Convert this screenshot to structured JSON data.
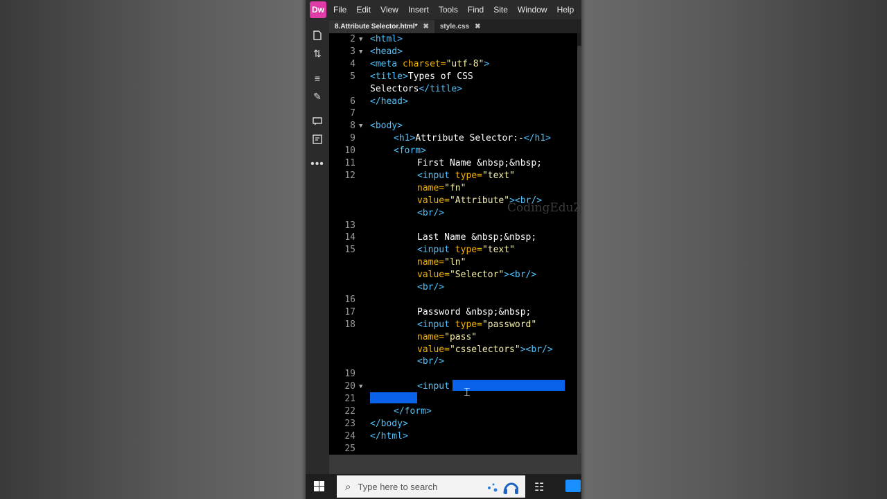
{
  "app": {
    "logo": "Dw",
    "menu": [
      "File",
      "Edit",
      "View",
      "Insert",
      "Tools",
      "Find",
      "Site",
      "Window",
      "Help"
    ]
  },
  "tabs": [
    {
      "label": "8.Attribute Selector.html*",
      "active": true
    },
    {
      "label": "style.css",
      "active": false
    }
  ],
  "toolbar_icons": [
    "file-icon",
    "sort-icon",
    "properties-icon",
    "brush-icon",
    "comment-icon",
    "code-nav-icon",
    "more-icon"
  ],
  "watermark": "CodingEduZ",
  "editor_lines": [
    {
      "n": "2",
      "fold": true,
      "indent": 0,
      "segs": [
        [
          "tag",
          "<html>"
        ]
      ]
    },
    {
      "n": "3",
      "fold": true,
      "indent": 0,
      "segs": [
        [
          "tag",
          "<head>"
        ]
      ]
    },
    {
      "n": "4",
      "fold": false,
      "indent": 0,
      "segs": [
        [
          "tag",
          "<meta "
        ],
        [
          "attr",
          "charset="
        ],
        [
          "str",
          "\"utf-8\""
        ],
        [
          "tag",
          ">"
        ]
      ]
    },
    {
      "n": "5",
      "fold": false,
      "indent": 0,
      "segs": [
        [
          "tag",
          "<title>"
        ],
        [
          "txt",
          "Types of CSS"
        ]
      ]
    },
    {
      "n": "",
      "fold": false,
      "indent": 0,
      "segs": [
        [
          "txt",
          "Selectors"
        ],
        [
          "tag",
          "</title>"
        ]
      ]
    },
    {
      "n": "6",
      "fold": false,
      "indent": 0,
      "segs": [
        [
          "tag",
          "</head>"
        ]
      ]
    },
    {
      "n": "7",
      "fold": false,
      "indent": 0,
      "segs": []
    },
    {
      "n": "8",
      "fold": true,
      "indent": 0,
      "segs": [
        [
          "tag",
          "<body>"
        ]
      ]
    },
    {
      "n": "9",
      "fold": false,
      "indent": 1,
      "segs": [
        [
          "tag",
          "<h1>"
        ],
        [
          "txt",
          "Attribute Selector:-"
        ],
        [
          "tag",
          "</h1>"
        ]
      ]
    },
    {
      "n": "10",
      "fold": false,
      "indent": 1,
      "segs": [
        [
          "tag",
          "<form>"
        ]
      ]
    },
    {
      "n": "11",
      "fold": false,
      "indent": 2,
      "segs": [
        [
          "txt",
          "First Name &nbsp;&nbsp;"
        ]
      ]
    },
    {
      "n": "12",
      "fold": false,
      "indent": 2,
      "segs": [
        [
          "tag",
          "<input "
        ],
        [
          "attr",
          "type="
        ],
        [
          "str",
          "\"text\""
        ]
      ]
    },
    {
      "n": "",
      "fold": false,
      "indent": 2,
      "segs": [
        [
          "attr",
          "name="
        ],
        [
          "str",
          "\"fn\""
        ]
      ]
    },
    {
      "n": "",
      "fold": false,
      "indent": 2,
      "segs": [
        [
          "attr",
          "value="
        ],
        [
          "str",
          "\"Attribute\""
        ],
        [
          "tag",
          "><br/>"
        ]
      ]
    },
    {
      "n": "",
      "fold": false,
      "indent": 2,
      "segs": [
        [
          "tag",
          "<br/>"
        ]
      ]
    },
    {
      "n": "13",
      "fold": false,
      "indent": 0,
      "segs": []
    },
    {
      "n": "14",
      "fold": false,
      "indent": 2,
      "segs": [
        [
          "txt",
          "Last Name &nbsp;&nbsp;"
        ]
      ]
    },
    {
      "n": "15",
      "fold": false,
      "indent": 2,
      "segs": [
        [
          "tag",
          "<input "
        ],
        [
          "attr",
          "type="
        ],
        [
          "str",
          "\"text\""
        ]
      ]
    },
    {
      "n": "",
      "fold": false,
      "indent": 2,
      "segs": [
        [
          "attr",
          "name="
        ],
        [
          "str",
          "\"ln\""
        ]
      ]
    },
    {
      "n": "",
      "fold": false,
      "indent": 2,
      "segs": [
        [
          "attr",
          "value="
        ],
        [
          "str",
          "\"Selector\""
        ],
        [
          "tag",
          "><br/>"
        ]
      ]
    },
    {
      "n": "",
      "fold": false,
      "indent": 2,
      "segs": [
        [
          "tag",
          "<br/>"
        ]
      ]
    },
    {
      "n": "16",
      "fold": false,
      "indent": 0,
      "segs": []
    },
    {
      "n": "17",
      "fold": false,
      "indent": 2,
      "segs": [
        [
          "txt",
          "Password &nbsp;&nbsp;"
        ]
      ]
    },
    {
      "n": "18",
      "fold": false,
      "indent": 2,
      "segs": [
        [
          "tag",
          "<input "
        ],
        [
          "attr",
          "type="
        ],
        [
          "str",
          "\"password\""
        ]
      ]
    },
    {
      "n": "",
      "fold": false,
      "indent": 2,
      "segs": [
        [
          "attr",
          "name="
        ],
        [
          "str",
          "\"pass\""
        ]
      ]
    },
    {
      "n": "",
      "fold": false,
      "indent": 2,
      "segs": [
        [
          "attr",
          "value="
        ],
        [
          "str",
          "\"csselectors\""
        ],
        [
          "tag",
          "><br/>"
        ]
      ]
    },
    {
      "n": "",
      "fold": false,
      "indent": 2,
      "segs": [
        [
          "tag",
          "<br/>"
        ]
      ]
    },
    {
      "n": "19",
      "fold": false,
      "indent": 0,
      "segs": []
    },
    {
      "n": "20",
      "fold": true,
      "indent": 2,
      "segs": [
        [
          "tag",
          "<input"
        ]
      ]
    },
    {
      "n": "21",
      "fold": false,
      "indent": 0,
      "segs": []
    },
    {
      "n": "22",
      "fold": false,
      "indent": 1,
      "segs": [
        [
          "tag",
          "</form>"
        ]
      ]
    },
    {
      "n": "23",
      "fold": false,
      "indent": 0,
      "segs": [
        [
          "tag",
          "</body>"
        ]
      ]
    },
    {
      "n": "24",
      "fold": false,
      "indent": 0,
      "segs": [
        [
          "tag",
          "</html>"
        ]
      ]
    },
    {
      "n": "25",
      "fold": false,
      "indent": 0,
      "segs": []
    }
  ],
  "taskbar": {
    "search_placeholder": "Type here to search"
  }
}
